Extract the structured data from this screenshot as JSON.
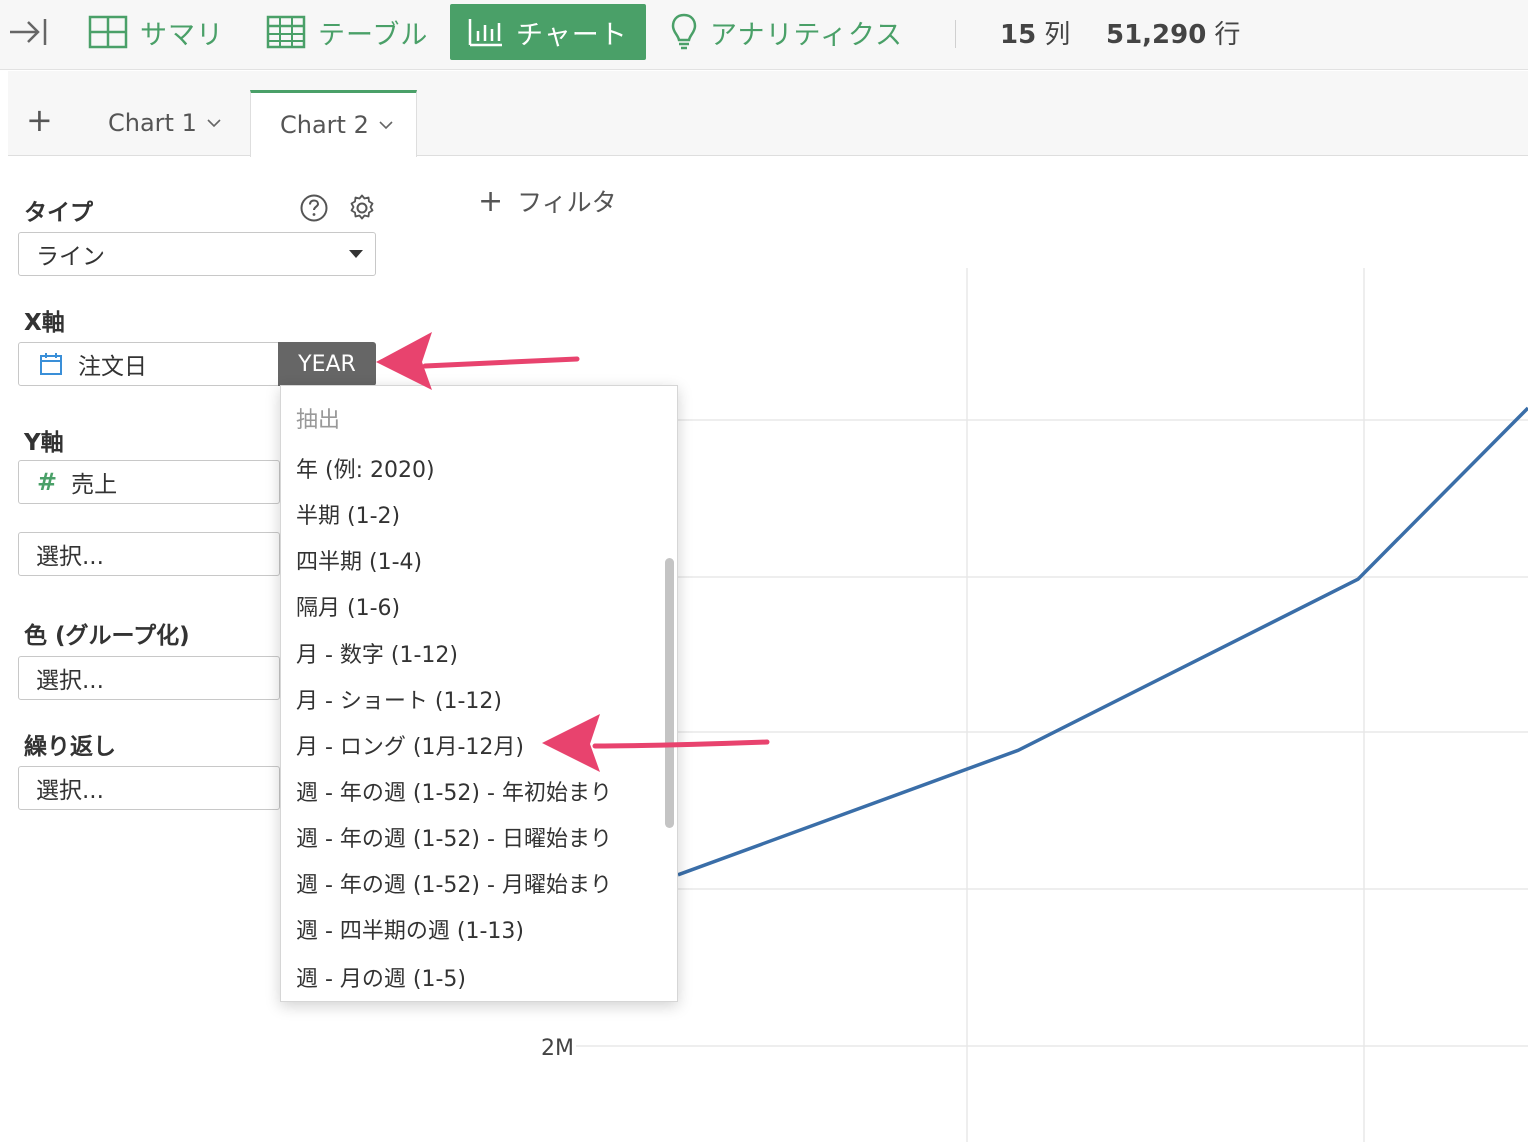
{
  "toolbar": {
    "nav": [
      {
        "label": "サマリ",
        "icon": "summary-grid-icon",
        "active": false
      },
      {
        "label": "テーブル",
        "icon": "table-icon",
        "active": false
      },
      {
        "label": "チャート",
        "icon": "bar-chart-icon",
        "active": true
      },
      {
        "label": "アナリティクス",
        "icon": "lightbulb-icon",
        "active": false
      }
    ],
    "columns_count": "15",
    "columns_unit": "列",
    "rows_count": "51,290",
    "rows_unit": "行"
  },
  "tabs": [
    {
      "label": "Chart 1",
      "active": false
    },
    {
      "label": "Chart 2",
      "active": true
    }
  ],
  "panel": {
    "type_label": "タイプ",
    "type_value": "ライン",
    "x_axis_label": "X軸",
    "x_field": "注文日",
    "x_function": "YEAR",
    "y_axis_label": "Y軸",
    "y_field": "売上",
    "y2_placeholder": "選択...",
    "color_label": "色 (グループ化)",
    "color_placeholder": "選択...",
    "repeat_label": "繰り返し",
    "repeat_placeholder": "選択..."
  },
  "filter_label": "フィルタ",
  "dropdown": {
    "header": "抽出",
    "items": [
      "年 (例: 2020)",
      "半期 (1-2)",
      "四半期 (1-4)",
      "隔月 (1-6)",
      "月 - 数字 (1-12)",
      "月 - ショート (1-12)",
      "月 - ロング (1月-12月)",
      "週 - 年の週 (1-52) - 年初始まり",
      "週 - 年の週 (1-52) - 日曜始まり",
      "週 - 年の週 (1-52) - 月曜始まり",
      "週 - 四半期の週 (1-13)",
      "週 - 月の週 (1-5)"
    ]
  },
  "colors": {
    "brand_green": "#4aa068",
    "line_blue": "#3a6ea8",
    "annotation_pink": "#e8436e"
  },
  "chart_data": {
    "type": "line",
    "y_tick_labels": [
      "2M"
    ],
    "series": [
      {
        "points": [
          [
            0.0,
            0.22
          ],
          [
            0.4,
            0.38
          ],
          [
            0.8,
            0.6
          ],
          [
            1.0,
            0.82
          ]
        ]
      }
    ]
  }
}
